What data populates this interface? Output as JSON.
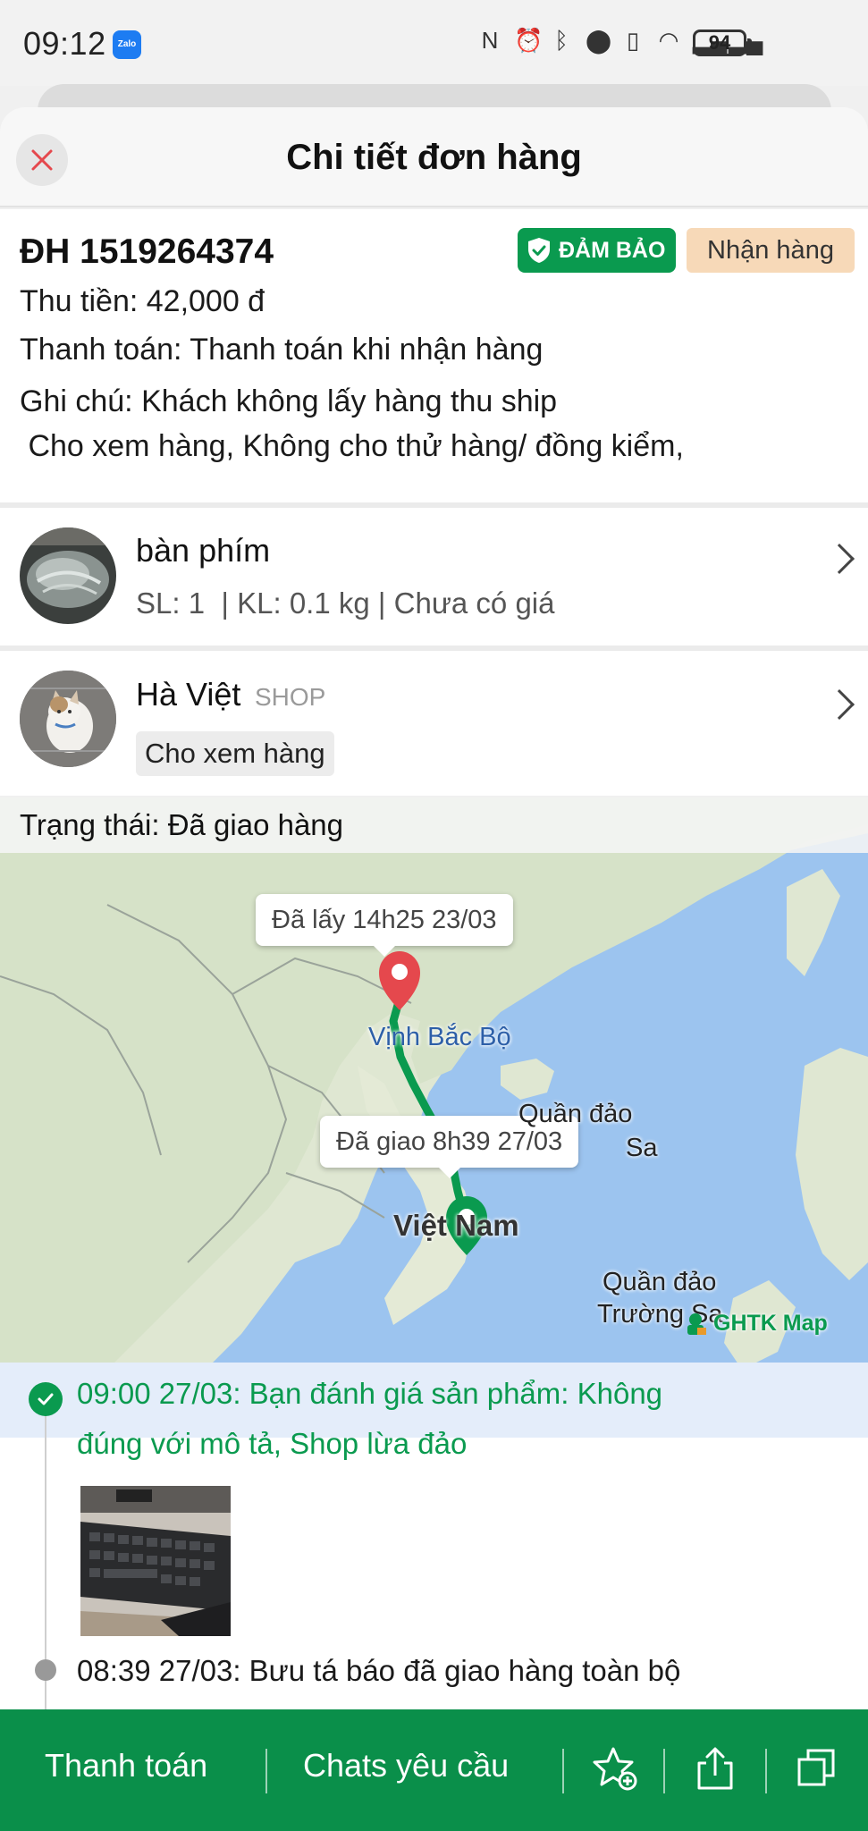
{
  "status_bar": {
    "time": "09:12",
    "zalo_label": "Zalo",
    "battery": "94"
  },
  "header": {
    "title": "Chi tiết đơn hàng"
  },
  "order": {
    "id": "ĐH 1519264374",
    "guarantee_badge": "ĐẢM BẢO",
    "status_badge": "Nhận hàng",
    "cod": "Thu tiền: 42,000 đ",
    "payment": "Thanh toán: Thanh toán khi nhận hàng",
    "note_line1": "Ghi chú: Khách không lấy hàng thu ship",
    "note_line2": " Cho xem hàng, Không cho thử hàng/ đồng kiểm,"
  },
  "product": {
    "name": "bàn phím",
    "meta": "SL: 1  | KL: 0.1 kg | Chưa có giá"
  },
  "shop": {
    "name": "Hà Việt",
    "tag": "SHOP",
    "chip": "Cho xem hàng"
  },
  "map": {
    "status": "Trạng thái: Đã giao hàng",
    "pickup_tooltip": "Đã lấy 14h25 23/03",
    "delivered_tooltip": "Đã giao 8h39 27/03",
    "label_gulf": "Vịnh Bắc Bộ",
    "label_paracel_1": "Quần đảo",
    "label_paracel_2": "Sa",
    "label_vietnam": "Việt Nam",
    "label_spratly_1": "Quần đảo",
    "label_spratly_2": "Trường Sa",
    "attribution": "GHTK Map",
    "colors": {
      "route": "#0a9a4f",
      "pickup_pin": "#e5484d",
      "delivered_pin": "#0a9a4f"
    }
  },
  "timeline": {
    "event1_line1": "09:00 27/03: Bạn đánh giá sản phẩm: Không",
    "event1_line2": "đúng với mô tả, Shop lừa đảo",
    "event2": "08:39 27/03: Bưu tá báo đã giao hàng toàn bộ"
  },
  "bottom_bar": {
    "pay_label": "Thanh toán",
    "chat_label": "Chats yêu cầu",
    "colors": {
      "background": "#0a8f4a"
    }
  }
}
